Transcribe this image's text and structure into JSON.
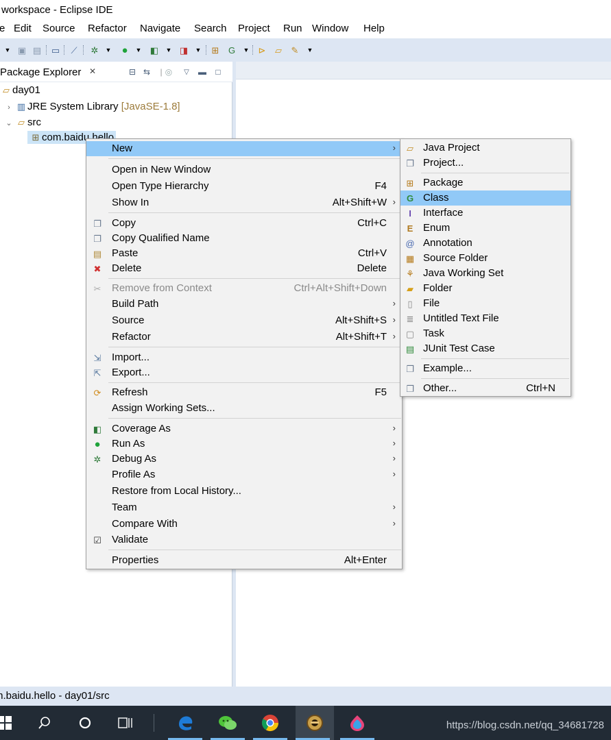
{
  "window": {
    "title": "workspace - Eclipse IDE"
  },
  "menubar": [
    "e",
    "Edit",
    "Source",
    "Refactor",
    "Navigate",
    "Search",
    "Project",
    "Run",
    "Window",
    "Help"
  ],
  "explorer": {
    "tab_label": "Package Explorer",
    "tree": {
      "project": "day01",
      "jre_label": "JRE System Library",
      "jre_version": "[JavaSE-1.8]",
      "src": "src",
      "package": "com.baidu.hello"
    }
  },
  "status": {
    "text": "m.baidu.hello - day01/src"
  },
  "taskbar": {
    "watermark": "https://blog.csdn.net/qq_34681728"
  },
  "context_menu": {
    "new": {
      "label": "New"
    },
    "open_new_window": {
      "label": "Open in New Window"
    },
    "open_type_hierarchy": {
      "label": "Open Type Hierarchy",
      "shortcut": "F4"
    },
    "show_in": {
      "label": "Show In",
      "shortcut": "Alt+Shift+W"
    },
    "copy": {
      "label": "Copy",
      "shortcut": "Ctrl+C"
    },
    "copy_qualified": {
      "label": "Copy Qualified Name"
    },
    "paste": {
      "label": "Paste",
      "shortcut": "Ctrl+V"
    },
    "delete": {
      "label": "Delete",
      "shortcut": "Delete"
    },
    "remove_context": {
      "label": "Remove from Context",
      "shortcut": "Ctrl+Alt+Shift+Down"
    },
    "build_path": {
      "label": "Build Path"
    },
    "source": {
      "label": "Source",
      "shortcut": "Alt+Shift+S"
    },
    "refactor": {
      "label": "Refactor",
      "shortcut": "Alt+Shift+T"
    },
    "import": {
      "label": "Import..."
    },
    "export": {
      "label": "Export..."
    },
    "refresh": {
      "label": "Refresh",
      "shortcut": "F5"
    },
    "assign_working_sets": {
      "label": "Assign Working Sets..."
    },
    "coverage_as": {
      "label": "Coverage As"
    },
    "run_as": {
      "label": "Run As"
    },
    "debug_as": {
      "label": "Debug As"
    },
    "profile_as": {
      "label": "Profile As"
    },
    "restore_history": {
      "label": "Restore from Local History..."
    },
    "team": {
      "label": "Team"
    },
    "compare_with": {
      "label": "Compare With"
    },
    "validate": {
      "label": "Validate"
    },
    "properties": {
      "label": "Properties",
      "shortcut": "Alt+Enter"
    }
  },
  "submenu": {
    "java_project": "Java Project",
    "project": "Project...",
    "package": "Package",
    "class": "Class",
    "interface": "Interface",
    "enum": "Enum",
    "annotation": "Annotation",
    "source_folder": "Source Folder",
    "java_working_set": "Java Working Set",
    "folder": "Folder",
    "file": "File",
    "untitled_text_file": "Untitled Text File",
    "task": "Task",
    "junit_test_case": "JUnit Test Case",
    "example": "Example...",
    "other": "Other...",
    "other_shortcut": "Ctrl+N"
  }
}
